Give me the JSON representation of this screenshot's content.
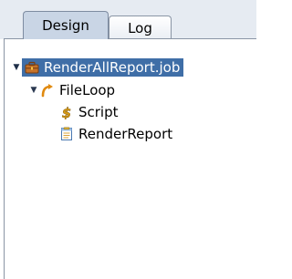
{
  "tabs": [
    {
      "label": "Design",
      "selected": true
    },
    {
      "label": "Log",
      "selected": false
    }
  ],
  "tree": {
    "root": {
      "label": "RenderAllReport.job",
      "icon": "job-briefcase-icon",
      "expanded": true,
      "selected": true
    },
    "fileloop": {
      "label": "FileLoop",
      "icon": "loop-arrow-icon",
      "expanded": true
    },
    "script": {
      "label": "Script",
      "icon": "script-dollar-icon"
    },
    "renderreport": {
      "label": "RenderReport",
      "icon": "report-document-icon"
    }
  },
  "colors": {
    "selection": "#3f6ea7",
    "tab_selected": "#c9d5e5",
    "tab_border": "#8a95a5"
  }
}
